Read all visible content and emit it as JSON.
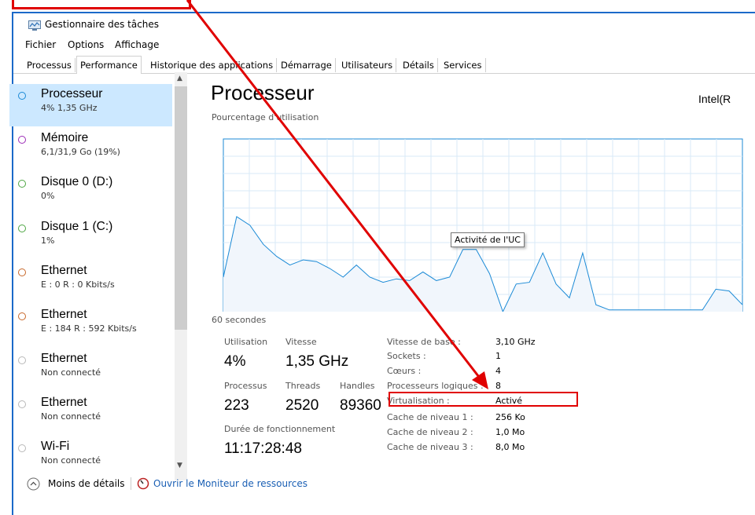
{
  "app": {
    "title": "Gestionnaire des tâches"
  },
  "menu": {
    "file": "Fichier",
    "options": "Options",
    "view": "Affichage"
  },
  "tabs": [
    "Processus",
    "Performance",
    "Historique des applications",
    "Démarrage",
    "Utilisateurs",
    "Détails",
    "Services"
  ],
  "sidebar": {
    "items": [
      {
        "name": "Processeur",
        "sub": "4% 1,35 GHz",
        "color": "#1b8ad6"
      },
      {
        "name": "Mémoire",
        "sub": "6,1/31,9 Go (19%)",
        "color": "#9c2bb7"
      },
      {
        "name": "Disque 0 (D:)",
        "sub": "0%",
        "color": "#4da642"
      },
      {
        "name": "Disque 1 (C:)",
        "sub": "1%",
        "color": "#4da642"
      },
      {
        "name": "Ethernet",
        "sub": "E : 0 R : 0 Kbits/s",
        "color": "#c8682a"
      },
      {
        "name": "Ethernet",
        "sub": "E : 184 R : 592 Kbits/s",
        "color": "#c8682a"
      },
      {
        "name": "Ethernet",
        "sub": "Non connecté",
        "color": "#b8b8b8"
      },
      {
        "name": "Ethernet",
        "sub": "Non connecté",
        "color": "#b8b8b8"
      },
      {
        "name": "Wi-Fi",
        "sub": "Non connecté",
        "color": "#b8b8b8"
      }
    ]
  },
  "main": {
    "title": "Processeur",
    "cpu_model": "Intel(R",
    "util_label": "Pourcentage d'utilisation",
    "time_label": "60 secondes",
    "tooltip": "Activité de l'UC",
    "stats": {
      "util_label": "Utilisation",
      "util_value": "4%",
      "speed_label": "Vitesse",
      "speed_value": "1,35 GHz",
      "proc_label": "Processus",
      "proc_value": "223",
      "threads_label": "Threads",
      "threads_value": "2520",
      "handles_label": "Handles",
      "handles_value": "89360",
      "uptime_label": "Durée de fonctionnement",
      "uptime_value": "11:17:28:48"
    },
    "specs": [
      {
        "label": "Vitesse de base :",
        "value": "3,10 GHz"
      },
      {
        "label": "Sockets :",
        "value": "1"
      },
      {
        "label": "Cœurs :",
        "value": "4"
      },
      {
        "label": "Processeurs logiques :",
        "value": "8"
      },
      {
        "label": "Virtualisation :",
        "value": "Activé"
      },
      {
        "label": "Cache de niveau 1 :",
        "value": "256 Ko"
      },
      {
        "label": "Cache de niveau 2 :",
        "value": "1,0 Mo"
      },
      {
        "label": "Cache de niveau 3 :",
        "value": "8,0 Mo"
      }
    ]
  },
  "graph": {
    "accent": "#1b8ad6",
    "values_pct": [
      20,
      55,
      50,
      39,
      32,
      27,
      30,
      29,
      25,
      20,
      27,
      20,
      17,
      19,
      18,
      23,
      18,
      20,
      36,
      36,
      22,
      0,
      16,
      17,
      34,
      16,
      8,
      34,
      4,
      1,
      1,
      1,
      1,
      1,
      1,
      1,
      1,
      13,
      12,
      4
    ]
  },
  "footer": {
    "less_details": "Moins de détails",
    "resource_monitor": "Ouvrir le Moniteur de ressources"
  },
  "annotation_color": "#e00000"
}
